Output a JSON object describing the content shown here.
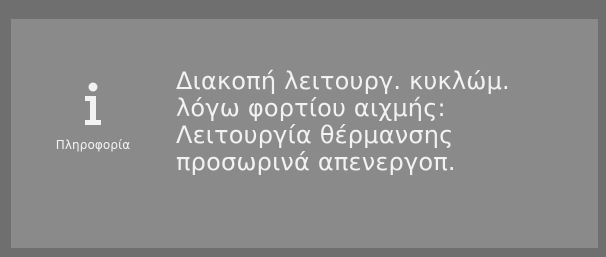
{
  "dialog": {
    "icon": "info-icon",
    "info_label": "Πληροφορία",
    "message_lines": [
      "Διακοπή λειτουργ. κυκλώμ.",
      "λόγω φορτίου αιχμής:",
      "Λειτουργία θέρμανσης",
      "προσωρινά απενεργοπ."
    ]
  },
  "colors": {
    "panel": "#8a8a8a",
    "frame": "#6f6f6f",
    "text": "#f2f2f2"
  }
}
